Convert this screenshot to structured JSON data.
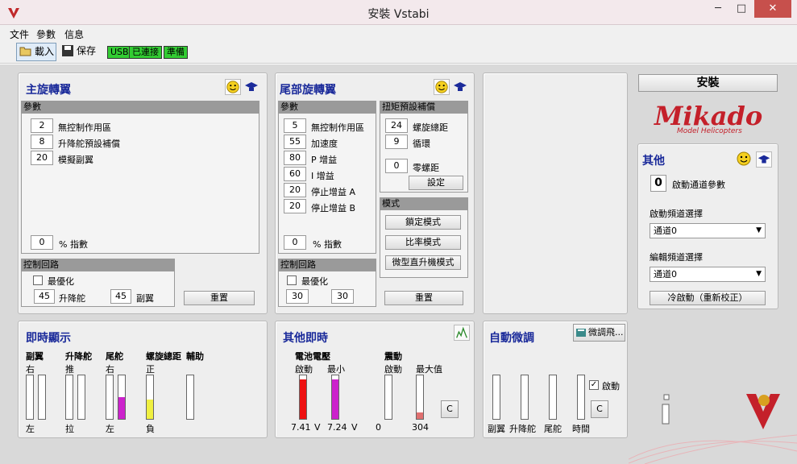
{
  "window": {
    "title": "安裝 Vstabi",
    "min": "─",
    "max": "□",
    "close": "✕"
  },
  "menu": [
    "文件",
    "參數",
    "信息"
  ],
  "toolbar": {
    "load": "載入",
    "save": "保存",
    "status": [
      "USB",
      "已連接",
      "準備"
    ]
  },
  "colors": {
    "title": "#1a2a9a",
    "status_green": "#33cc33",
    "bar_red": "#ee1111",
    "bar_magenta": "#cc22cc",
    "bar_yellow": "#f0f040"
  },
  "main_rotor": {
    "title": "主旋轉翼",
    "params_header": "參數",
    "params": [
      {
        "value": "2",
        "label": "無控制作用區"
      },
      {
        "value": "8",
        "label": "升降舵預設補償"
      },
      {
        "value": "20",
        "label": "模擬副翼"
      }
    ],
    "exp_value": "0",
    "exp_label": "% 指數",
    "control_header": "控制回路",
    "optimize_label": "最優化",
    "elevator_value": "45",
    "elevator_label": "升降舵",
    "aileron_value": "45",
    "aileron_label": "副翼",
    "reset": "重置"
  },
  "tail_rotor": {
    "title": "尾部旋轉翼",
    "params_header": "參數",
    "params": [
      {
        "value": "5",
        "label": "無控制作用區"
      },
      {
        "value": "55",
        "label": "加速度"
      },
      {
        "value": "80",
        "label": "P 增益"
      },
      {
        "value": "60",
        "label": "I 增益"
      },
      {
        "value": "20",
        "label": "停止增益 A"
      },
      {
        "value": "20",
        "label": "停止增益 B"
      }
    ],
    "exp_value": "0",
    "exp_label": "% 指數",
    "torque_header": "扭矩預設補償",
    "torque": [
      {
        "value": "24",
        "label": "螺旋總距"
      },
      {
        "value": "9",
        "label": "循環"
      },
      {
        "value": "0",
        "label": "零螺距"
      }
    ],
    "settings": "設定",
    "mode_header": "模式",
    "modes": [
      "鎖定模式",
      "比率模式",
      "微型直升機模式"
    ],
    "control_header": "控制回路",
    "optimize_label": "最優化",
    "v1": "30",
    "v2": "30",
    "reset": "重置"
  },
  "right": {
    "install": "安裝",
    "brand": "Mikado",
    "brand_sub": "Model Helicopters",
    "other_title": "其他",
    "start_channel_value": "0",
    "start_channel_label": "啟動通道參數",
    "start_freq_label": "啟動頻道選擇",
    "start_freq_value": "通道0",
    "edit_freq_label": "編輯頻道選擇",
    "edit_freq_value": "通道0",
    "cold_start": "冷啟動（重新校正）"
  },
  "realtime": {
    "title": "即時顯示",
    "groups": [
      {
        "name": "副翼",
        "top": "右",
        "bottom": "左"
      },
      {
        "name": "升降舵",
        "top": "推",
        "bottom": "拉"
      },
      {
        "name": "尾舵",
        "top": "右",
        "bottom": "左"
      },
      {
        "name": "螺旋總距",
        "top": "正",
        "bottom": "負"
      },
      {
        "name": "輔助",
        "top": "",
        "bottom": ""
      }
    ],
    "levels": {
      "tail_right": 0.5,
      "pitch": 0.45
    }
  },
  "other_realtime": {
    "title": "其他即時",
    "battery_label": "電池電壓",
    "start_label": "啟動",
    "min_label": "最小",
    "vib_label": "震動",
    "vib_start_label": "啟動",
    "vib_max_label": "最大值",
    "battery_start": "7.41",
    "battery_min": "7.24",
    "unit": "V",
    "vib_start": "0",
    "vib_max": "304",
    "clear": "C",
    "levels": {
      "battery_start": 0.9,
      "battery_min": 0.9,
      "vib_start": 0,
      "vib_max": 0.15
    }
  },
  "autotrim": {
    "title": "自動微調",
    "trim_button": "微調飛...",
    "labels": [
      "副翼",
      "升降舵",
      "尾舵",
      "時間"
    ],
    "enable_label": "啟動",
    "clear": "C"
  }
}
